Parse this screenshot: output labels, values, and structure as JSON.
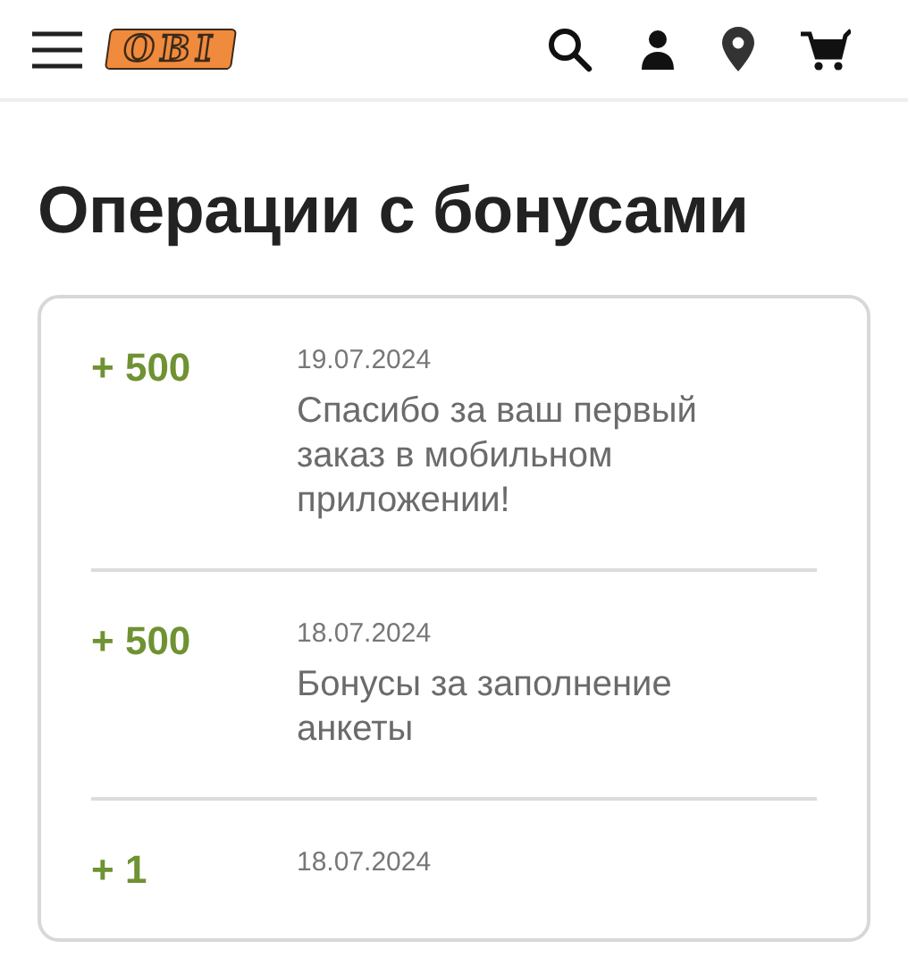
{
  "header": {
    "logo": "OBI"
  },
  "title": "Операции с бонусами",
  "operations": [
    {
      "amount": "+ 500",
      "date": "19.07.2024",
      "description": "Спасибо за ваш первый заказ в мобильном приложении!"
    },
    {
      "amount": "+ 500",
      "date": "18.07.2024",
      "description": "Бонусы за заполнение анкеты"
    },
    {
      "amount": "+ 1",
      "date": "18.07.2024"
    }
  ]
}
